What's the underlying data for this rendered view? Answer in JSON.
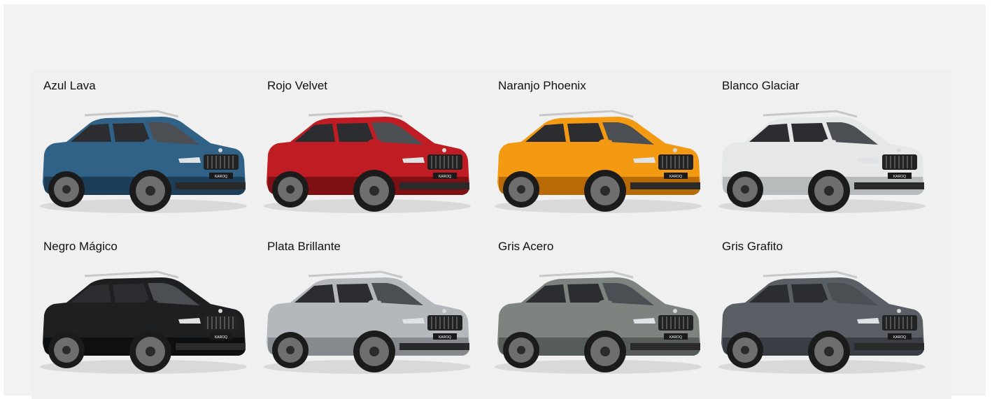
{
  "colors": [
    {
      "name": "Azul Lava",
      "paint": "#2f6286",
      "paint_dark": "#1c3e58",
      "roof": "#2f6286"
    },
    {
      "name": "Rojo Velvet",
      "paint": "#bf1d23",
      "paint_dark": "#7e1014",
      "roof": "#bf1d23"
    },
    {
      "name": "Naranjo Phoenix",
      "paint": "#f39a12",
      "paint_dark": "#b76a05",
      "roof": "#f39a12"
    },
    {
      "name": "Blanco Glaciar",
      "paint": "#e6e7e7",
      "paint_dark": "#b8bbbb",
      "roof": "#e6e7e7"
    },
    {
      "name": "Negro Mágico",
      "paint": "#1e1f21",
      "paint_dark": "#0e0f10",
      "roof": "#1e1f21"
    },
    {
      "name": "Plata Brillante",
      "paint": "#b4b8bc",
      "paint_dark": "#868a8e",
      "roof": "#b4b8bc"
    },
    {
      "name": "Gris Acero",
      "paint": "#7d837e",
      "paint_dark": "#565c58",
      "roof": "#7d837e"
    },
    {
      "name": "Gris Grafito",
      "paint": "#5a5f66",
      "paint_dark": "#3a3e44",
      "roof": "#5a5f66"
    }
  ],
  "badge_text": "KAROQ"
}
